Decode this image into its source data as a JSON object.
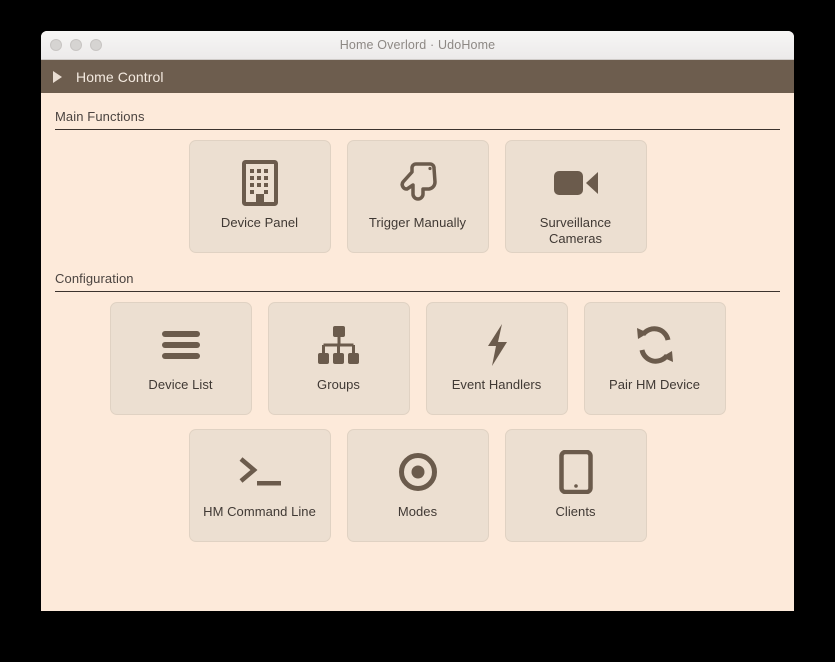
{
  "window": {
    "title": "Home Overlord · UdoHome",
    "traffic_lights": [
      "close",
      "minimize",
      "maximize"
    ]
  },
  "toolbar": {
    "back_icon": "play-triangle-icon",
    "title": "Home Control"
  },
  "sections": [
    {
      "id": "main-functions",
      "title": "Main Functions",
      "rows": [
        [
          {
            "label": "Device Panel",
            "icon": "building-icon"
          },
          {
            "label": "Trigger Manually",
            "icon": "pointing-hand-icon"
          },
          {
            "label": "Surveillance Cameras",
            "icon": "video-camera-icon"
          }
        ]
      ]
    },
    {
      "id": "configuration",
      "title": "Configuration",
      "rows": [
        [
          {
            "label": "Device List",
            "icon": "list-lines-icon"
          },
          {
            "label": "Groups",
            "icon": "sitemap-icon"
          },
          {
            "label": "Event Handlers",
            "icon": "lightning-bolt-icon"
          },
          {
            "label": "Pair HM Device",
            "icon": "sync-arrows-icon"
          }
        ],
        [
          {
            "label": "HM Command Line",
            "icon": "terminal-prompt-icon"
          },
          {
            "label": "Modes",
            "icon": "target-dot-icon"
          },
          {
            "label": "Clients",
            "icon": "tablet-icon"
          }
        ]
      ]
    }
  ],
  "colors": {
    "window_background": "#fdeada",
    "toolbar": "#6d5d4e",
    "card_background": "#ecdfd1",
    "icon": "#6b5b4c",
    "text": "#403934",
    "rule": "#3c332d"
  }
}
